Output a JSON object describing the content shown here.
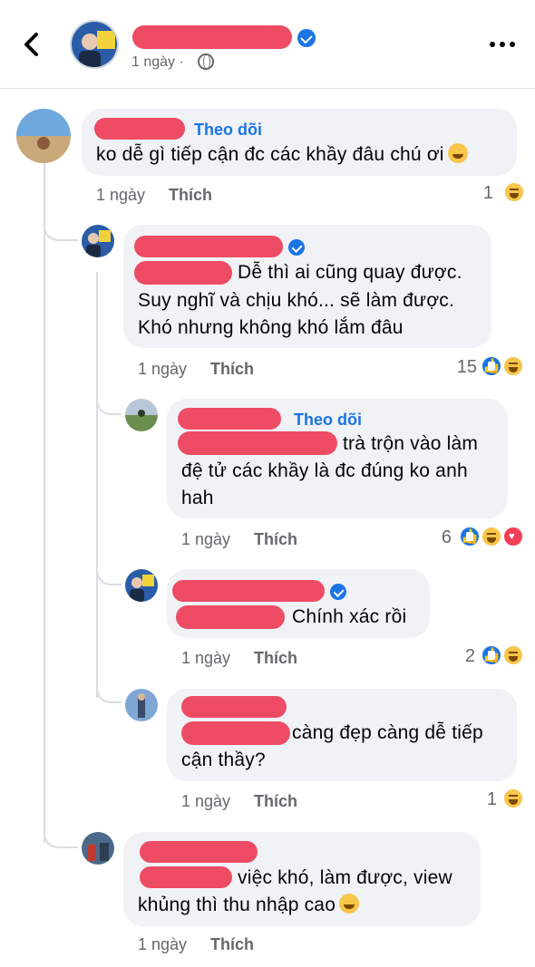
{
  "header": {
    "back_label": "Quay lại",
    "time": "1 ngày ·",
    "more_label": "···"
  },
  "comments": [
    {
      "follow": "Theo dõi",
      "text": [
        "ko dễ gì tiếp cận đc các khầy đâu chú ơi"
      ],
      "time": "1 ngày",
      "like": "Thích",
      "count": "1",
      "text_emoji": "laugh-tears-emoji",
      "reactions": [
        "haha"
      ]
    },
    {
      "text": [
        "Dễ thì ai cũng quay được.",
        "Suy nghĩ và chịu khó... sẽ làm được.",
        "Khó nhưng không khó lắm đâu"
      ],
      "time": "1 ngày",
      "like": "Thích",
      "count": "15",
      "reactions": [
        "like",
        "haha"
      ]
    },
    {
      "follow": "Theo dõi",
      "text": [
        "trà trộn vào làm",
        "đệ tử các khầy là đc đúng ko anh",
        "hah"
      ],
      "time": "1 ngày",
      "like": "Thích",
      "count": "6",
      "reactions": [
        "like",
        "haha",
        "love"
      ]
    },
    {
      "text": [
        "Chính xác rồi"
      ],
      "time": "1 ngày",
      "like": "Thích",
      "count": "2",
      "reactions": [
        "like",
        "haha"
      ]
    },
    {
      "text": [
        "càng đẹp càng dễ tiếp",
        "cận thầy?"
      ],
      "time": "1 ngày",
      "like": "Thích",
      "count": "1",
      "reactions": [
        "haha"
      ]
    },
    {
      "text": [
        "việc khó, làm được, view",
        "khủng thì thu nhập cao"
      ],
      "time": "1 ngày",
      "like": "Thích",
      "text_emoji": "grin-emoji"
    }
  ],
  "colors": {
    "accent": "#1b74e4",
    "redaction": "#ee4b65",
    "bubble": "#f0f2f5",
    "meta": "#65676b"
  }
}
